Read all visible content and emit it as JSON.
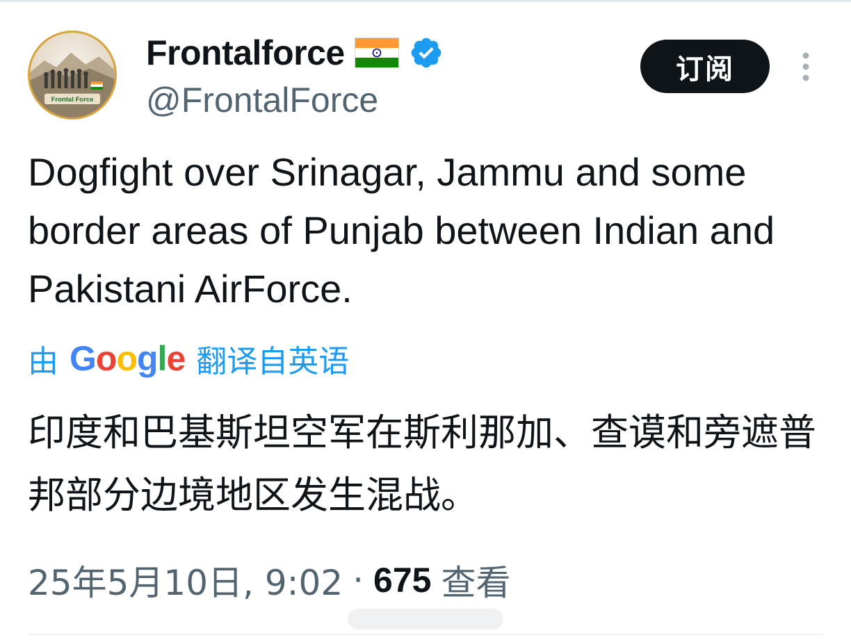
{
  "author": {
    "display_name": "Frontalforce",
    "handle": "@FrontalForce",
    "avatar_text": "Frontal Force",
    "flag_icon": "india-flag-icon",
    "verified_icon": "verified-badge-icon",
    "verified_color": "#1d9bf0"
  },
  "header": {
    "subscribe_label": "订阅",
    "more_icon": "more-vertical-icon"
  },
  "tweet": {
    "text": "Dogfight over Srinagar, Jammu and some border areas of Punjab between Indian and Pakistani AirForce."
  },
  "translation": {
    "prefix": "由",
    "provider_letters": [
      "G",
      "o",
      "o",
      "g",
      "l",
      "e"
    ],
    "suffix": "翻译自英语",
    "translated_text": "印度和巴基斯坦空军在斯利那加、查谟和旁遮普邦部分边境地区发生混战。"
  },
  "meta": {
    "timestamp": "25年5月10日, 9:02",
    "separator": "·",
    "views_count": "675",
    "views_label": "查看"
  },
  "colors": {
    "link_blue": "#1d9bf0",
    "text_primary": "#0f1419",
    "text_secondary": "#536471",
    "button_bg": "#0f1419"
  }
}
